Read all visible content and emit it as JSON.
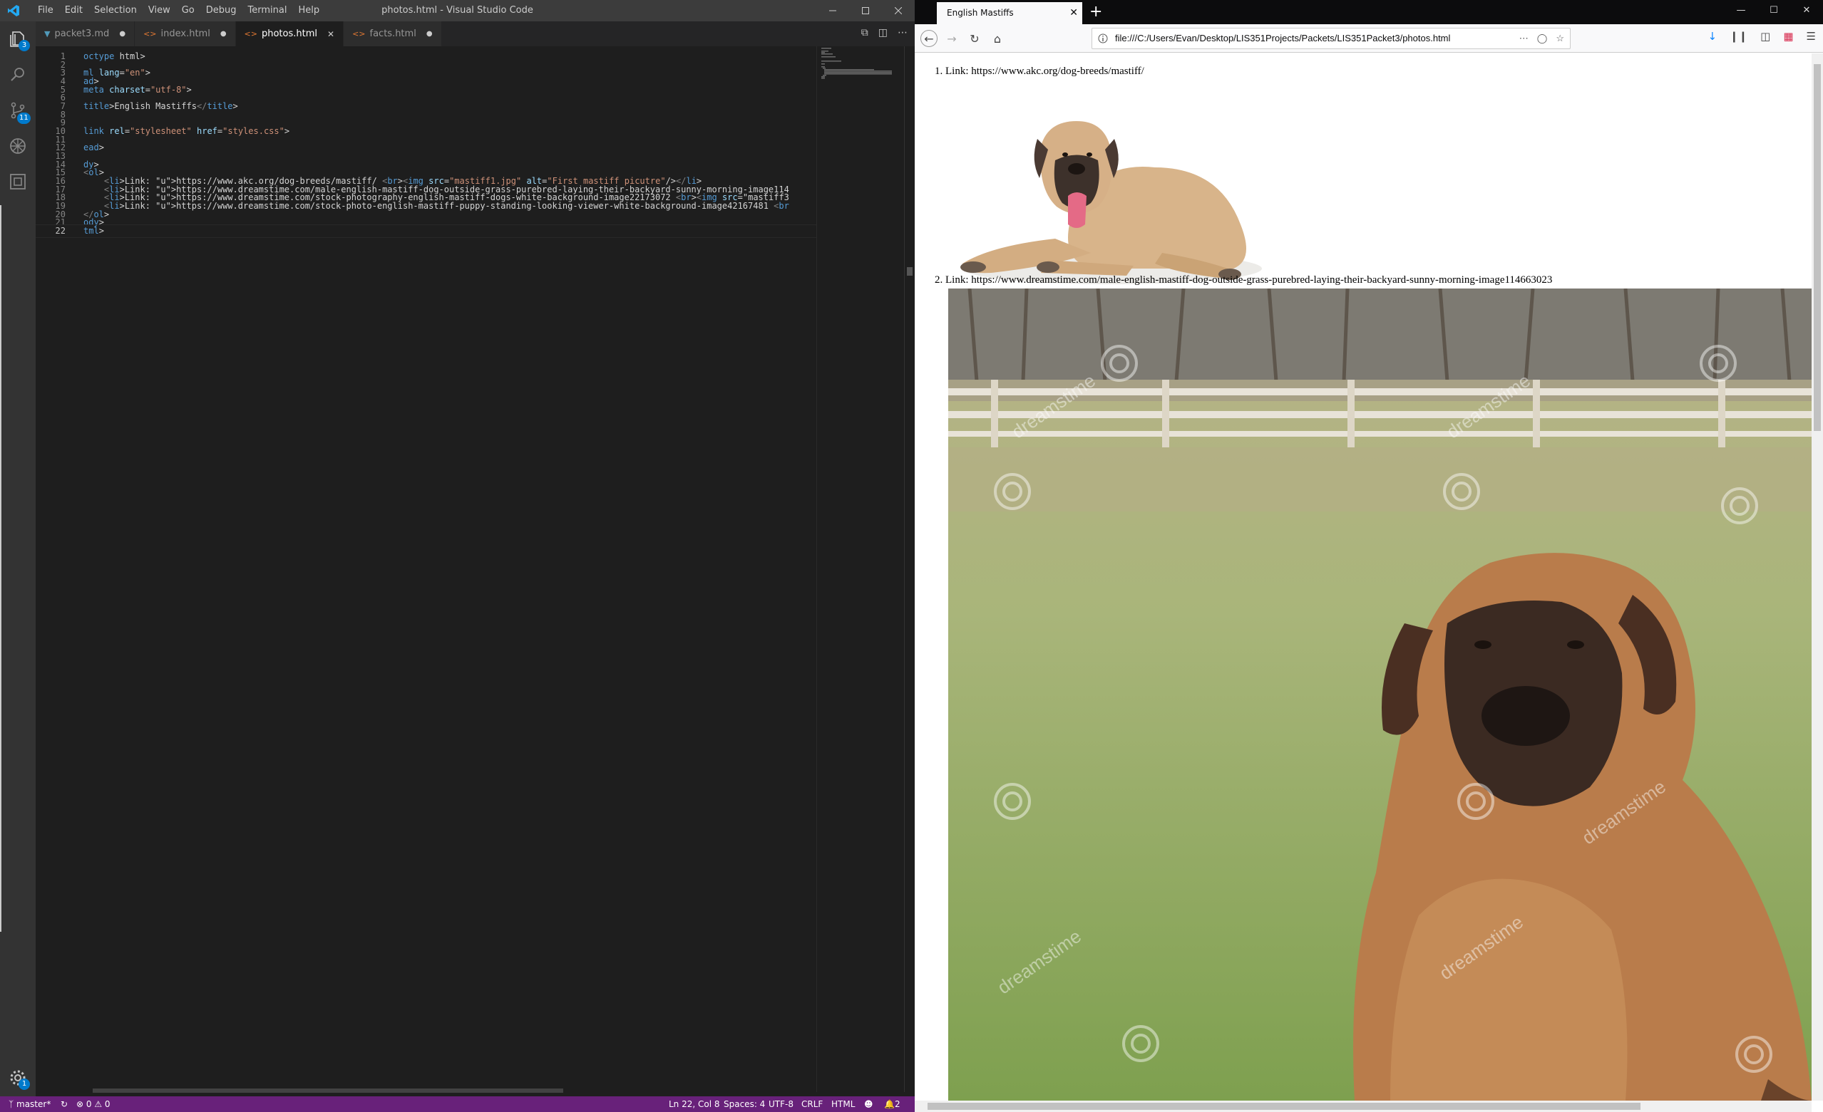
{
  "vscode": {
    "window_title": "photos.html - Visual Studio Code",
    "menu": [
      "File",
      "Edit",
      "Selection",
      "View",
      "Go",
      "Debug",
      "Terminal",
      "Help"
    ],
    "tabs": [
      {
        "label": "packet3.md",
        "icon": "markdown-icon",
        "state": "modified"
      },
      {
        "label": "index.html",
        "icon": "html-icon",
        "state": "modified"
      },
      {
        "label": "photos.html",
        "icon": "html-icon",
        "state": "active"
      },
      {
        "label": "facts.html",
        "icon": "html-icon",
        "state": "modified"
      }
    ],
    "activity_badges": {
      "explorer": "3",
      "source_control": "11",
      "settings": "1"
    },
    "code_lines": [
      "octype html>",
      "",
      "ml lang=\"en\">",
      "ad>",
      "meta charset=\"utf-8\">",
      "",
      "title>English Mastiffs</title>",
      "",
      "",
      "link rel=\"stylesheet\" href=\"styles.css\">",
      "",
      "ead>",
      "",
      "dy>",
      "<ol>",
      "    <li>Link: https://www.akc.org/dog-breeds/mastiff/ <br><img src=\"mastiff1.jpg\" alt=\"First mastiff picutre\"/></li>",
      "    <li>Link: https://www.dreamstime.com/male-english-mastiff-dog-outside-grass-purebred-laying-their-backyard-sunny-morning-image114",
      "    <li>Link: https://www.dreamstime.com/stock-photography-english-mastiff-dogs-white-background-image22173072 <br><img src=\"mastiff3",
      "    <li>Link: https://www.dreamstime.com/stock-photo-english-mastiff-puppy-standing-looking-viewer-white-background-image42167481 <br",
      "</ol>",
      "ody>",
      "tml>"
    ],
    "current_line": 22,
    "status": {
      "branch": "master*",
      "errors": "0",
      "warnings": "0",
      "position": "Ln 22, Col 8",
      "spaces": "Spaces: 4",
      "encoding": "UTF-8",
      "eol": "CRLF",
      "language": "HTML",
      "notifications": "2"
    }
  },
  "firefox": {
    "tab_title": "English Mastiffs",
    "url": "file:///C:/Users/Evan/Desktop/LIS351Projects/Packets/LIS351Packet3/photos.html",
    "list_items": [
      "1. Link: https://www.akc.org/dog-breeds/mastiff/",
      "2. Link: https://www.dreamstime.com/male-english-mastiff-dog-outside-grass-purebred-laying-their-backyard-sunny-morning-image114663023"
    ],
    "watermark": "dreamstime"
  }
}
